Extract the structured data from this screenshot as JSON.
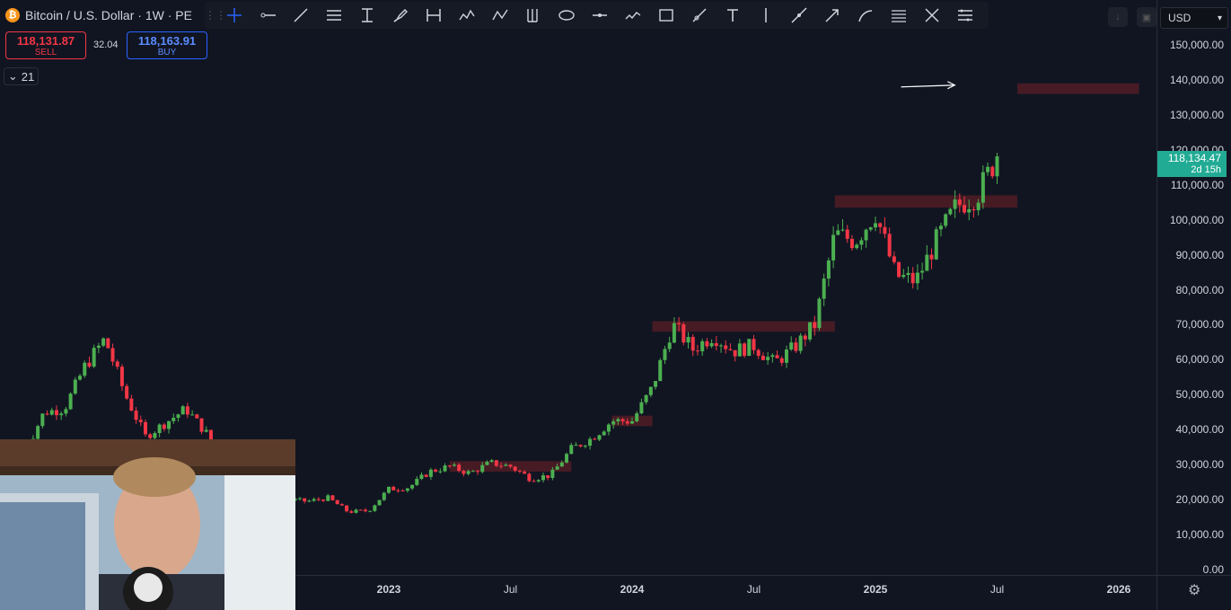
{
  "header": {
    "symbol_title": "Bitcoin / U.S. Dollar · 1W · PE",
    "btc_icon_glyph": "₿",
    "sell_price": "118,131.87",
    "sell_label": "SELL",
    "buy_price": "118,163.91",
    "buy_label": "BUY",
    "spread": "32.04",
    "indicator_count": "21"
  },
  "toolbar": {
    "tools": [
      {
        "name": "crosshair-icon",
        "active": true
      },
      {
        "name": "horizontal-ray-icon"
      },
      {
        "name": "trend-line-icon"
      },
      {
        "name": "parallel-channel-icon"
      },
      {
        "name": "price-range-icon"
      },
      {
        "name": "brush-icon"
      },
      {
        "name": "date-range-icon"
      },
      {
        "name": "elliott-wave-icon"
      },
      {
        "name": "abcd-pattern-icon"
      },
      {
        "name": "pitchfork-icon"
      },
      {
        "name": "ellipse-icon"
      },
      {
        "name": "horizontal-line-icon"
      },
      {
        "name": "path-icon"
      },
      {
        "name": "rectangle-icon"
      },
      {
        "name": "ray-icon"
      },
      {
        "name": "text-icon"
      },
      {
        "name": "vertical-line-icon"
      },
      {
        "name": "extended-line-icon"
      },
      {
        "name": "arrow-icon"
      },
      {
        "name": "curve-icon"
      },
      {
        "name": "fib-retracement-icon"
      },
      {
        "name": "cross-line-icon"
      },
      {
        "name": "toolbar-settings-icon"
      }
    ]
  },
  "currency": "USD",
  "current_price": {
    "price": "118,134.47",
    "countdown": "2d 15h",
    "color": "#22ab94"
  },
  "colors": {
    "background": "#111522",
    "up": "#4caf50",
    "down": "#f23645",
    "zone": "#5a1e26"
  },
  "chart_data": {
    "type": "candlestick",
    "title": "Bitcoin / U.S. Dollar · 1W",
    "ylim": [
      0,
      150000
    ],
    "y_ticks": [
      "150,000.00",
      "140,000.00",
      "130,000.00",
      "120,000.00",
      "110,000.00",
      "100,000.00",
      "90,000.00",
      "80,000.00",
      "70,000.00",
      "60,000.00",
      "50,000.00",
      "40,000.00",
      "30,000.00",
      "20,000.00",
      "10,000.00",
      "0.00"
    ],
    "x_ticks": [
      {
        "label": "2023",
        "date": "2023-01",
        "year": true
      },
      {
        "label": "Jul",
        "date": "2023-07",
        "year": false
      },
      {
        "label": "2024",
        "date": "2024-01",
        "year": true
      },
      {
        "label": "Jul",
        "date": "2024-07",
        "year": false
      },
      {
        "label": "2025",
        "date": "2025-01",
        "year": true
      },
      {
        "label": "Jul",
        "date": "2025-07",
        "year": false
      },
      {
        "label": "2026",
        "date": "2026-01",
        "year": true
      }
    ],
    "price_path": [
      [
        "2021-07",
        33000
      ],
      [
        "2021-08",
        45000
      ],
      [
        "2021-09",
        46000
      ],
      [
        "2021-10",
        58000
      ],
      [
        "2021-11",
        66000
      ],
      [
        "2021-12",
        50000
      ],
      [
        "2022-01",
        38000
      ],
      [
        "2022-02",
        42000
      ],
      [
        "2022-03",
        46000
      ],
      [
        "2022-04",
        39000
      ],
      [
        "2022-05",
        30000
      ],
      [
        "2022-06",
        20000
      ],
      [
        "2022-07",
        23000
      ],
      [
        "2022-08",
        20000
      ],
      [
        "2022-09",
        19500
      ],
      [
        "2022-10",
        20500
      ],
      [
        "2022-11",
        16500
      ],
      [
        "2022-12",
        16800
      ],
      [
        "2023-01",
        23000
      ],
      [
        "2023-02",
        23500
      ],
      [
        "2023-03",
        28000
      ],
      [
        "2023-04",
        29500
      ],
      [
        "2023-05",
        27500
      ],
      [
        "2023-06",
        30500
      ],
      [
        "2023-07",
        29500
      ],
      [
        "2023-08",
        26000
      ],
      [
        "2023-09",
        27000
      ],
      [
        "2023-10",
        34500
      ],
      [
        "2023-11",
        37500
      ],
      [
        "2023-12",
        42500
      ],
      [
        "2024-01",
        42500
      ],
      [
        "2024-02",
        52000
      ],
      [
        "2024-03",
        70000
      ],
      [
        "2024-04",
        63000
      ],
      [
        "2024-05",
        67000
      ],
      [
        "2024-06",
        62500
      ],
      [
        "2024-07",
        64000
      ],
      [
        "2024-08",
        59000
      ],
      [
        "2024-09",
        63500
      ],
      [
        "2024-10",
        70000
      ],
      [
        "2024-11",
        96000
      ],
      [
        "2024-12",
        94000
      ],
      [
        "2025-01",
        102000
      ],
      [
        "2025-02",
        84000
      ],
      [
        "2025-03",
        82500
      ],
      [
        "2025-04",
        94000
      ],
      [
        "2025-05",
        104000
      ],
      [
        "2025-06",
        107000
      ],
      [
        "2025-07",
        118134
      ]
    ],
    "zones": [
      {
        "from": "2023-04",
        "to": "2023-10",
        "low": 28000,
        "high": 31000
      },
      {
        "from": "2023-12",
        "to": "2024-02",
        "low": 41000,
        "high": 44000
      },
      {
        "from": "2024-02",
        "to": "2024-11",
        "low": 68000,
        "high": 71000
      },
      {
        "from": "2024-11",
        "to": "2025-08",
        "low": 103500,
        "high": 107000
      },
      {
        "from": "2025-08",
        "to": "2026-02",
        "low": 136000,
        "high": 139000
      }
    ],
    "annotations": [
      {
        "type": "arrow",
        "from": [
          "2025-02",
          138500
        ],
        "to": [
          "2025-05",
          138500
        ]
      }
    ]
  }
}
